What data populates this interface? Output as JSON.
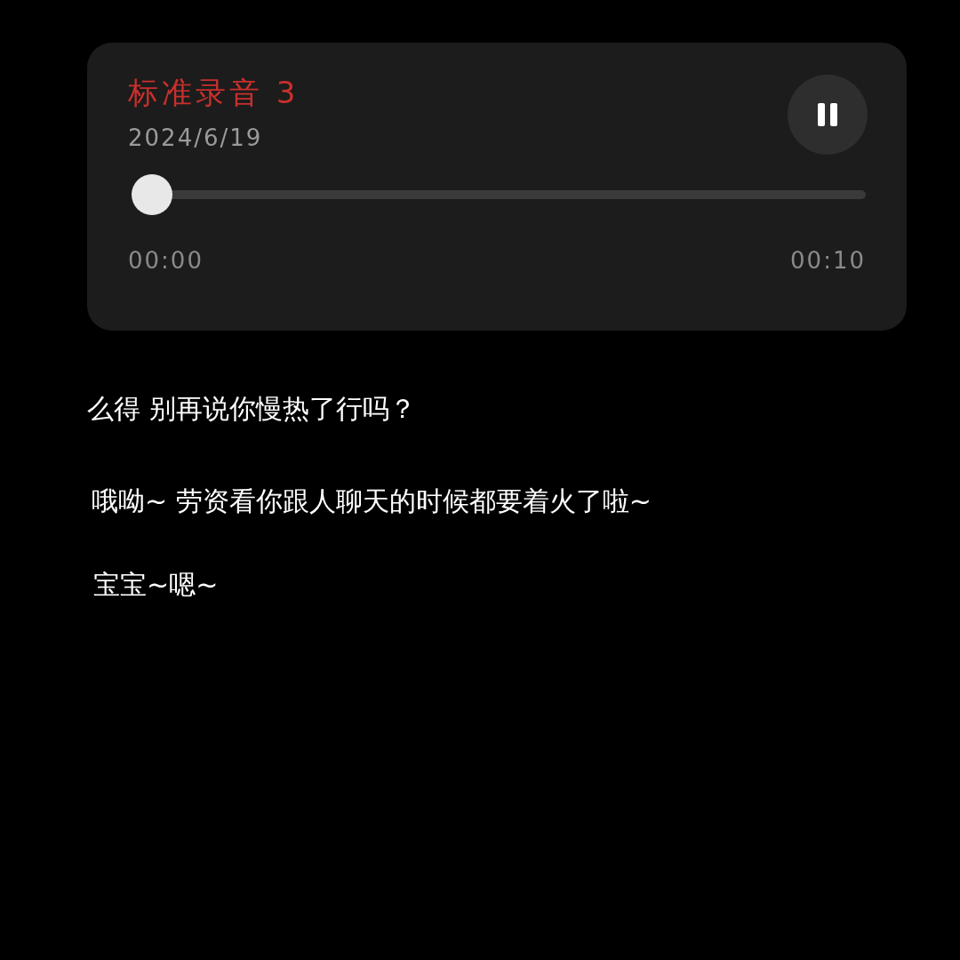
{
  "recording": {
    "title": "标准录音 3",
    "date": "2024/6/19",
    "playing": true,
    "progress": {
      "level": 0
    },
    "elapsed": "00:00",
    "duration": "00:10"
  },
  "captions": [
    "么得 别再说你慢热了行吗？",
    "哦呦~ 劳资看你跟人聊天的时候都要着火了啦~",
    "宝宝~嗯~"
  ]
}
